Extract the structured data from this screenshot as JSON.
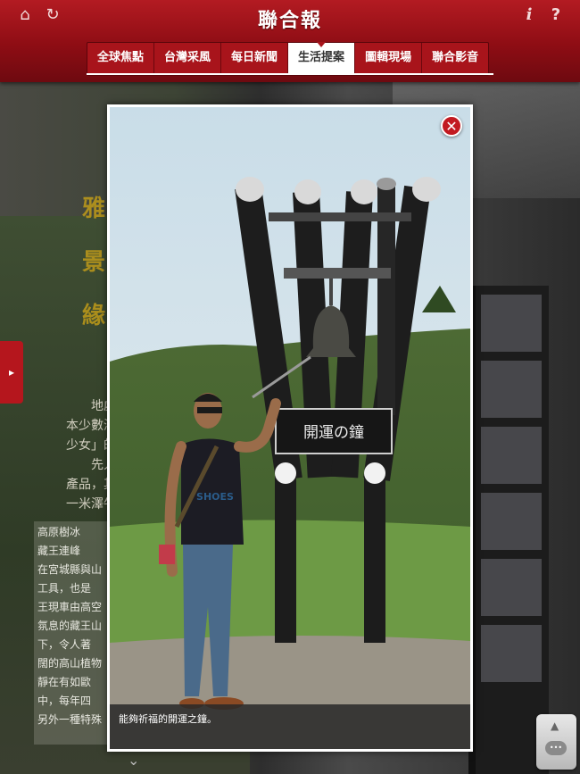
{
  "header": {
    "logo": "聯合報",
    "icons": {
      "home": "home-icon",
      "refresh": "refresh-icon",
      "info": "info-icon",
      "help": "help-icon"
    }
  },
  "nav": {
    "tabs": [
      {
        "label": "全球焦點",
        "active": false
      },
      {
        "label": "台灣采風",
        "active": false
      },
      {
        "label": "每日新聞",
        "active": false
      },
      {
        "label": "生活提案",
        "active": true
      },
      {
        "label": "圖輯現場",
        "active": false
      },
      {
        "label": "聯合影音",
        "active": false
      }
    ]
  },
  "background": {
    "title": "雅景緣",
    "body_lines": [
      "地處",
      "本少數海",
      "少女」的",
      "先入",
      "產品，其",
      "一米澤牛"
    ],
    "box_title": "高原樹冰",
    "box_lines": [
      "藏王連峰",
      "在宮城縣與山",
      "工具，也是",
      "王現車由高空",
      "氛息的藏王山",
      "下，令人著",
      "闊的高山植物",
      "靜在有如歐",
      "中，每年四",
      "另外一種特殊"
    ]
  },
  "modal": {
    "caption": "能夠祈福的開運之鐘。",
    "sign_text": "開運の鐘",
    "shirt_text": "SHOES"
  },
  "colors": {
    "brand_red": "#b31b22",
    "tab_active_bg": "#ffffff"
  }
}
